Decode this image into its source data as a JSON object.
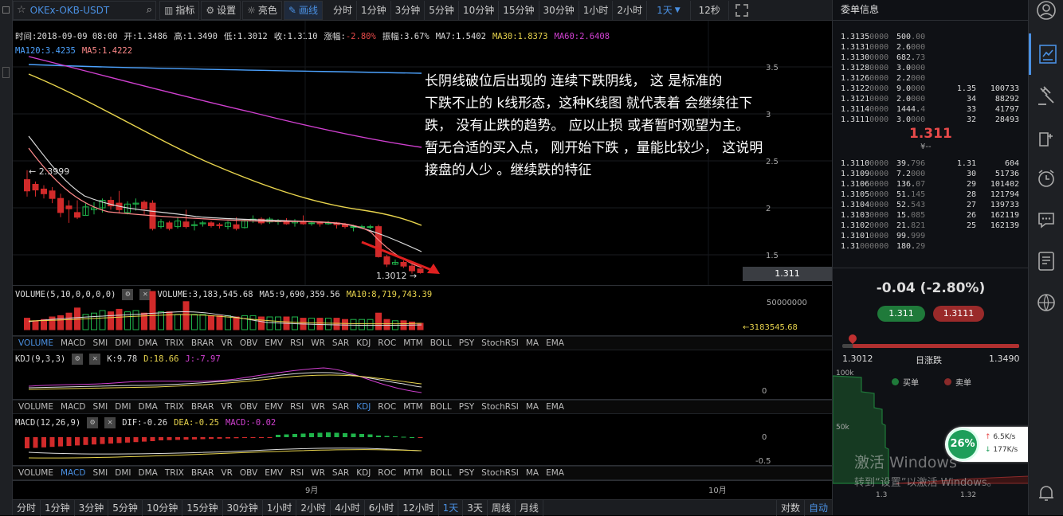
{
  "toolbar": {
    "symbol": "OKEx-OKB-USDT",
    "indicators_btn": "指标",
    "settings_btn": "设置",
    "theme_btn": "亮色",
    "draw_btn": "画线",
    "timeframes": [
      "分时",
      "1分钟",
      "3分钟",
      "5分钟",
      "10分钟",
      "15分钟",
      "30分钟",
      "1小时",
      "2小时"
    ],
    "selected_tf": "1天",
    "refresh": "12秒"
  },
  "candle_info": {
    "time": "时间:2018-09-09 08:00",
    "open": "开:1.3486",
    "high": "高:1.3490",
    "low": "低:1.3012",
    "close": "收:1.3110",
    "change": "涨幅:-2.80%",
    "amplitude": "振幅:3.67%",
    "ma7": "MA7:1.5402",
    "ma30": "MA30:1.8373",
    "ma60": "MA60:2.6408",
    "ma120": "MA120:3.4235",
    "ma5": "MA5:1.4222"
  },
  "price_axis": [
    "3.5",
    "3",
    "2.5",
    "2",
    "1.5"
  ],
  "current_price_tag": "1.311",
  "max_marker": "← 2.3999",
  "min_marker": "1.3012 →",
  "annotation": [
    "长阴线破位后出现的 连续下跌阴线， 这 是标准的",
    "下跌不止的 k线形态，这种K线图 就代表着 会继续往下",
    " 跌， 没有止跌的趋势。 应以止损 或者暂时观望为主。",
    "暂无合适的买入点，  刚开始下跌 ，量能比较少， 这说明",
    "接盘的人少 。继续跌的特征"
  ],
  "volume": {
    "title": "VOLUME(5,10,0,0,0,0)",
    "value": "VOLUME:3,183,545.68",
    "ma5": "MA5:9,690,359.56",
    "ma10": "MA10:8,719,743.39",
    "axis": "50000000",
    "tag": "←3183545.68"
  },
  "indicator_tabs": [
    "VOLUME",
    "MACD",
    "SMI",
    "DMI",
    "DMA",
    "TRIX",
    "BRAR",
    "VR",
    "OBV",
    "EMV",
    "RSI",
    "WR",
    "SAR",
    "KDJ",
    "ROC",
    "MTM",
    "BOLL",
    "PSY",
    "StochRSI",
    "MA",
    "EMA"
  ],
  "kdj": {
    "title": "KDJ(9,3,3)",
    "k": "K:9.78",
    "d": "D:18.66",
    "j": "J:-7.97",
    "axis": "0"
  },
  "macd": {
    "title": "MACD(12,26,9)",
    "dif": "DIF:-0.26",
    "dea": "DEA:-0.25",
    "macd": "MACD:-0.02",
    "axis_top": "0",
    "axis_bottom": "-0.5"
  },
  "time_axis": [
    "9月",
    "10月"
  ],
  "bottom": {
    "periods": [
      "分时",
      "1分钟",
      "3分钟",
      "5分钟",
      "10分钟",
      "15分钟",
      "30分钟",
      "1小时",
      "2小时",
      "4小时",
      "6小时",
      "12小时",
      "1天",
      "3天",
      "周线",
      "月线"
    ],
    "selected": "1天",
    "log": "对数",
    "auto": "自动"
  },
  "orderbook": {
    "title": "委单信息",
    "asks": [
      {
        "p": "1.3135",
        "pz": "0000",
        "a": "500",
        "az": ".00",
        "c": "",
        "t": ""
      },
      {
        "p": "1.3131",
        "pz": "0000",
        "a": "2.6",
        "az": "000",
        "c": "",
        "t": ""
      },
      {
        "p": "1.3130",
        "pz": "0000",
        "a": "682.",
        "az": "73",
        "c": "",
        "t": ""
      },
      {
        "p": "1.3128",
        "pz": "0000",
        "a": "3.0",
        "az": "000",
        "c": "",
        "t": ""
      },
      {
        "p": "1.3126",
        "pz": "0000",
        "a": "2.2",
        "az": "000",
        "c": "",
        "t": ""
      },
      {
        "p": "1.3122",
        "pz": "0000",
        "a": "9.0",
        "az": "000",
        "c": "1.35",
        "t": "100733"
      },
      {
        "p": "1.3121",
        "pz": "0000",
        "a": "2.0",
        "az": "000",
        "c": "34",
        "t": "88292"
      },
      {
        "p": "1.3114",
        "pz": "0000",
        "a": "1444.",
        "az": "4",
        "c": "33",
        "t": "41797"
      },
      {
        "p": "1.3111",
        "pz": "0000",
        "a": "3.0",
        "az": "000",
        "c": "32",
        "t": "28493"
      }
    ],
    "last": "1.311",
    "last_sub": "¥--",
    "bids": [
      {
        "p": "1.3110",
        "pz": "0000",
        "a": "39.",
        "az": "796",
        "c": "1.31",
        "t": "604"
      },
      {
        "p": "1.3109",
        "pz": "0000",
        "a": "7.2",
        "az": "000",
        "c": "30",
        "t": "51736"
      },
      {
        "p": "1.3106",
        "pz": "0000",
        "a": "136.",
        "az": "07",
        "c": "29",
        "t": "101402"
      },
      {
        "p": "1.3105",
        "pz": "0000",
        "a": "51.",
        "az": "145",
        "c": "28",
        "t": "121794"
      },
      {
        "p": "1.3104",
        "pz": "0000",
        "a": "52.",
        "az": "543",
        "c": "27",
        "t": "139733"
      },
      {
        "p": "1.3103",
        "pz": "0000",
        "a": "15.",
        "az": "085",
        "c": "26",
        "t": "162119"
      },
      {
        "p": "1.3102",
        "pz": "0000",
        "a": "21.",
        "az": "821",
        "c": "25",
        "t": "162139"
      },
      {
        "p": "1.3101",
        "pz": "0000",
        "a": "99.",
        "az": "999",
        "c": "",
        "t": ""
      },
      {
        "p": "1.31",
        "pz": "000000",
        "a": "180.",
        "az": "29",
        "c": "",
        "t": ""
      }
    ]
  },
  "ticker": {
    "change": "-0.04 (-2.80%)",
    "buy": "1.311",
    "sell": "1.3111",
    "low": "1.3012",
    "label": "日涨跌",
    "high": "1.3490",
    "range_fraction": 0.06
  },
  "depth": {
    "y_top": "100k",
    "y_mid": "50k",
    "buy_legend": "买单",
    "sell_legend": "卖单",
    "x_left": "1.3",
    "x_right": "1.32"
  },
  "speed": {
    "percent": "26%",
    "up": "6.5K/s",
    "down": "177K/s"
  },
  "watermark": {
    "title": "激活 Windows",
    "sub": "转到“设置”以激活 Windows。"
  }
}
